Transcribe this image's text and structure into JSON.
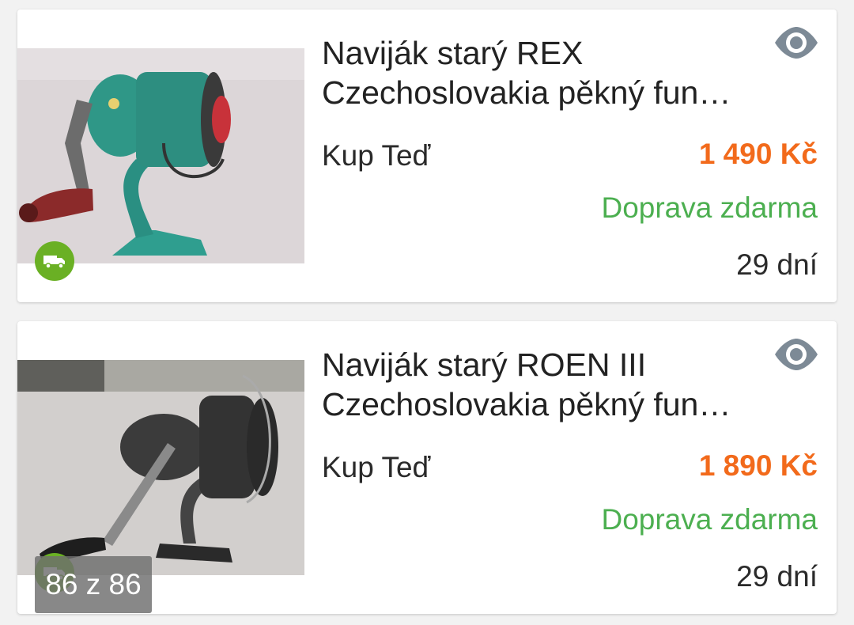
{
  "listings": [
    {
      "title_line1": "Naviják starý REX",
      "title_line2": "Czechoslovakia pěkný fun…",
      "buy_label": "Kup Teď",
      "price": "1 490 Kč",
      "shipping": "Doprava zdarma",
      "time_left": "29 dní",
      "image": "green-fishing-reel-photo"
    },
    {
      "title_line1": "Naviják starý ROEN III",
      "title_line2": "Czechoslovakia pěkný fun…",
      "buy_label": "Kup Teď",
      "price": "1 890 Kč",
      "shipping": "Doprava zdarma",
      "time_left": "29 dní",
      "image": "gray-fishing-reel-photo"
    }
  ],
  "pager": {
    "counter": "86 z 86"
  },
  "colors": {
    "price": "#f26a1b",
    "shipping": "#4caf50",
    "badge": "#6ab024",
    "eye_icon": "#7d8a96"
  },
  "icons": [
    "eye-icon",
    "truck-icon"
  ]
}
